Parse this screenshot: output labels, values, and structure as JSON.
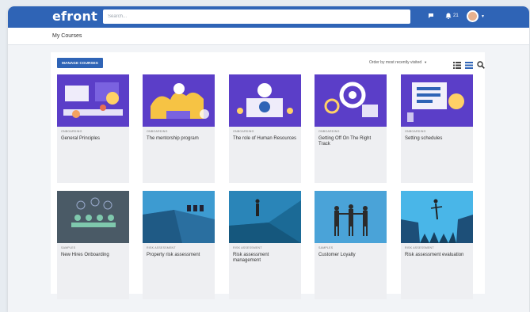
{
  "header": {
    "logo": "efront",
    "search_placeholder": "Search...",
    "notification_count": "21"
  },
  "subheader": {
    "title": "My Courses"
  },
  "toolbar": {
    "manage_label": "MANAGE COURSES",
    "sort_label": "Order by most recently visited"
  },
  "colors": {
    "brand": "#2f64b6",
    "card_purple": "#5b3ec8",
    "card_teal": "#2a85b8",
    "card_slate": "#4a5a66"
  },
  "courses": [
    {
      "category": "ONBOARDING",
      "name": "General Principles",
      "art": "purple"
    },
    {
      "category": "ONBOARDING",
      "name": "The mentorship program",
      "art": "purple"
    },
    {
      "category": "ONBOARDING",
      "name": "The role of Human Resources",
      "art": "purple"
    },
    {
      "category": "ONBOARDING",
      "name": "Getting Off On The Right Track",
      "art": "purple"
    },
    {
      "category": "ONBOARDING",
      "name": "Setting schedules",
      "art": "purple"
    },
    {
      "category": "SAMPLES",
      "name": "New Hires Onboarding",
      "art": "slate"
    },
    {
      "category": "RISK ASSESSMENT",
      "name": "Property risk assessment",
      "art": "teal"
    },
    {
      "category": "RISK ASSESSMENT",
      "name": "Risk assessment management",
      "art": "teal"
    },
    {
      "category": "SAMPLES",
      "name": "Customer Loyalty",
      "art": "teal"
    },
    {
      "category": "RISK ASSESSMENT",
      "name": "Risk assessment evaluation",
      "art": "teal"
    }
  ]
}
